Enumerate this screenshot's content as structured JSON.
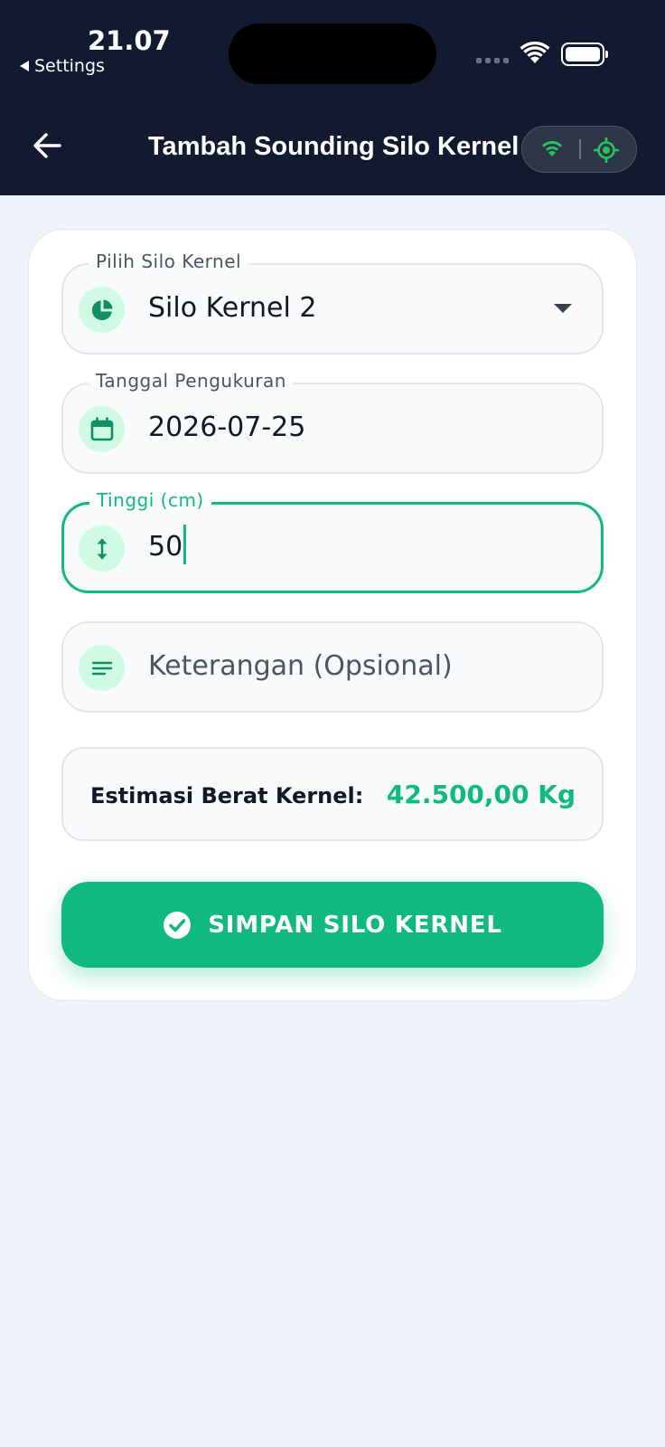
{
  "status_bar": {
    "time": "21.07",
    "back_app": "Settings"
  },
  "header": {
    "title": "Tambah Sounding Silo Kernel",
    "icons": [
      "back-arrow-icon",
      "wifi-icon",
      "gps-target-icon"
    ]
  },
  "form": {
    "silo": {
      "label": "Pilih Silo Kernel",
      "value": "Silo Kernel 2",
      "icon": "pie-chart-icon"
    },
    "date": {
      "label": "Tanggal Pengukuran",
      "value": "2026-07-25",
      "icon": "calendar-icon"
    },
    "height": {
      "label": "Tinggi (cm)",
      "value": "50",
      "icon": "vertical-arrows-icon"
    },
    "notes": {
      "placeholder": "Keterangan (Opsional)",
      "icon": "notes-lines-icon"
    },
    "estimate": {
      "label": "Estimasi Berat Kernel:",
      "value": "42.500,00 Kg"
    },
    "submit": {
      "label": "SIMPAN SILO KERNEL",
      "icon": "check-circle-icon"
    }
  },
  "colors": {
    "header_bg": "#111a2e",
    "accent": "#10b981",
    "accent_light": "#d1fae5",
    "page_bg": "#eff2f8"
  }
}
